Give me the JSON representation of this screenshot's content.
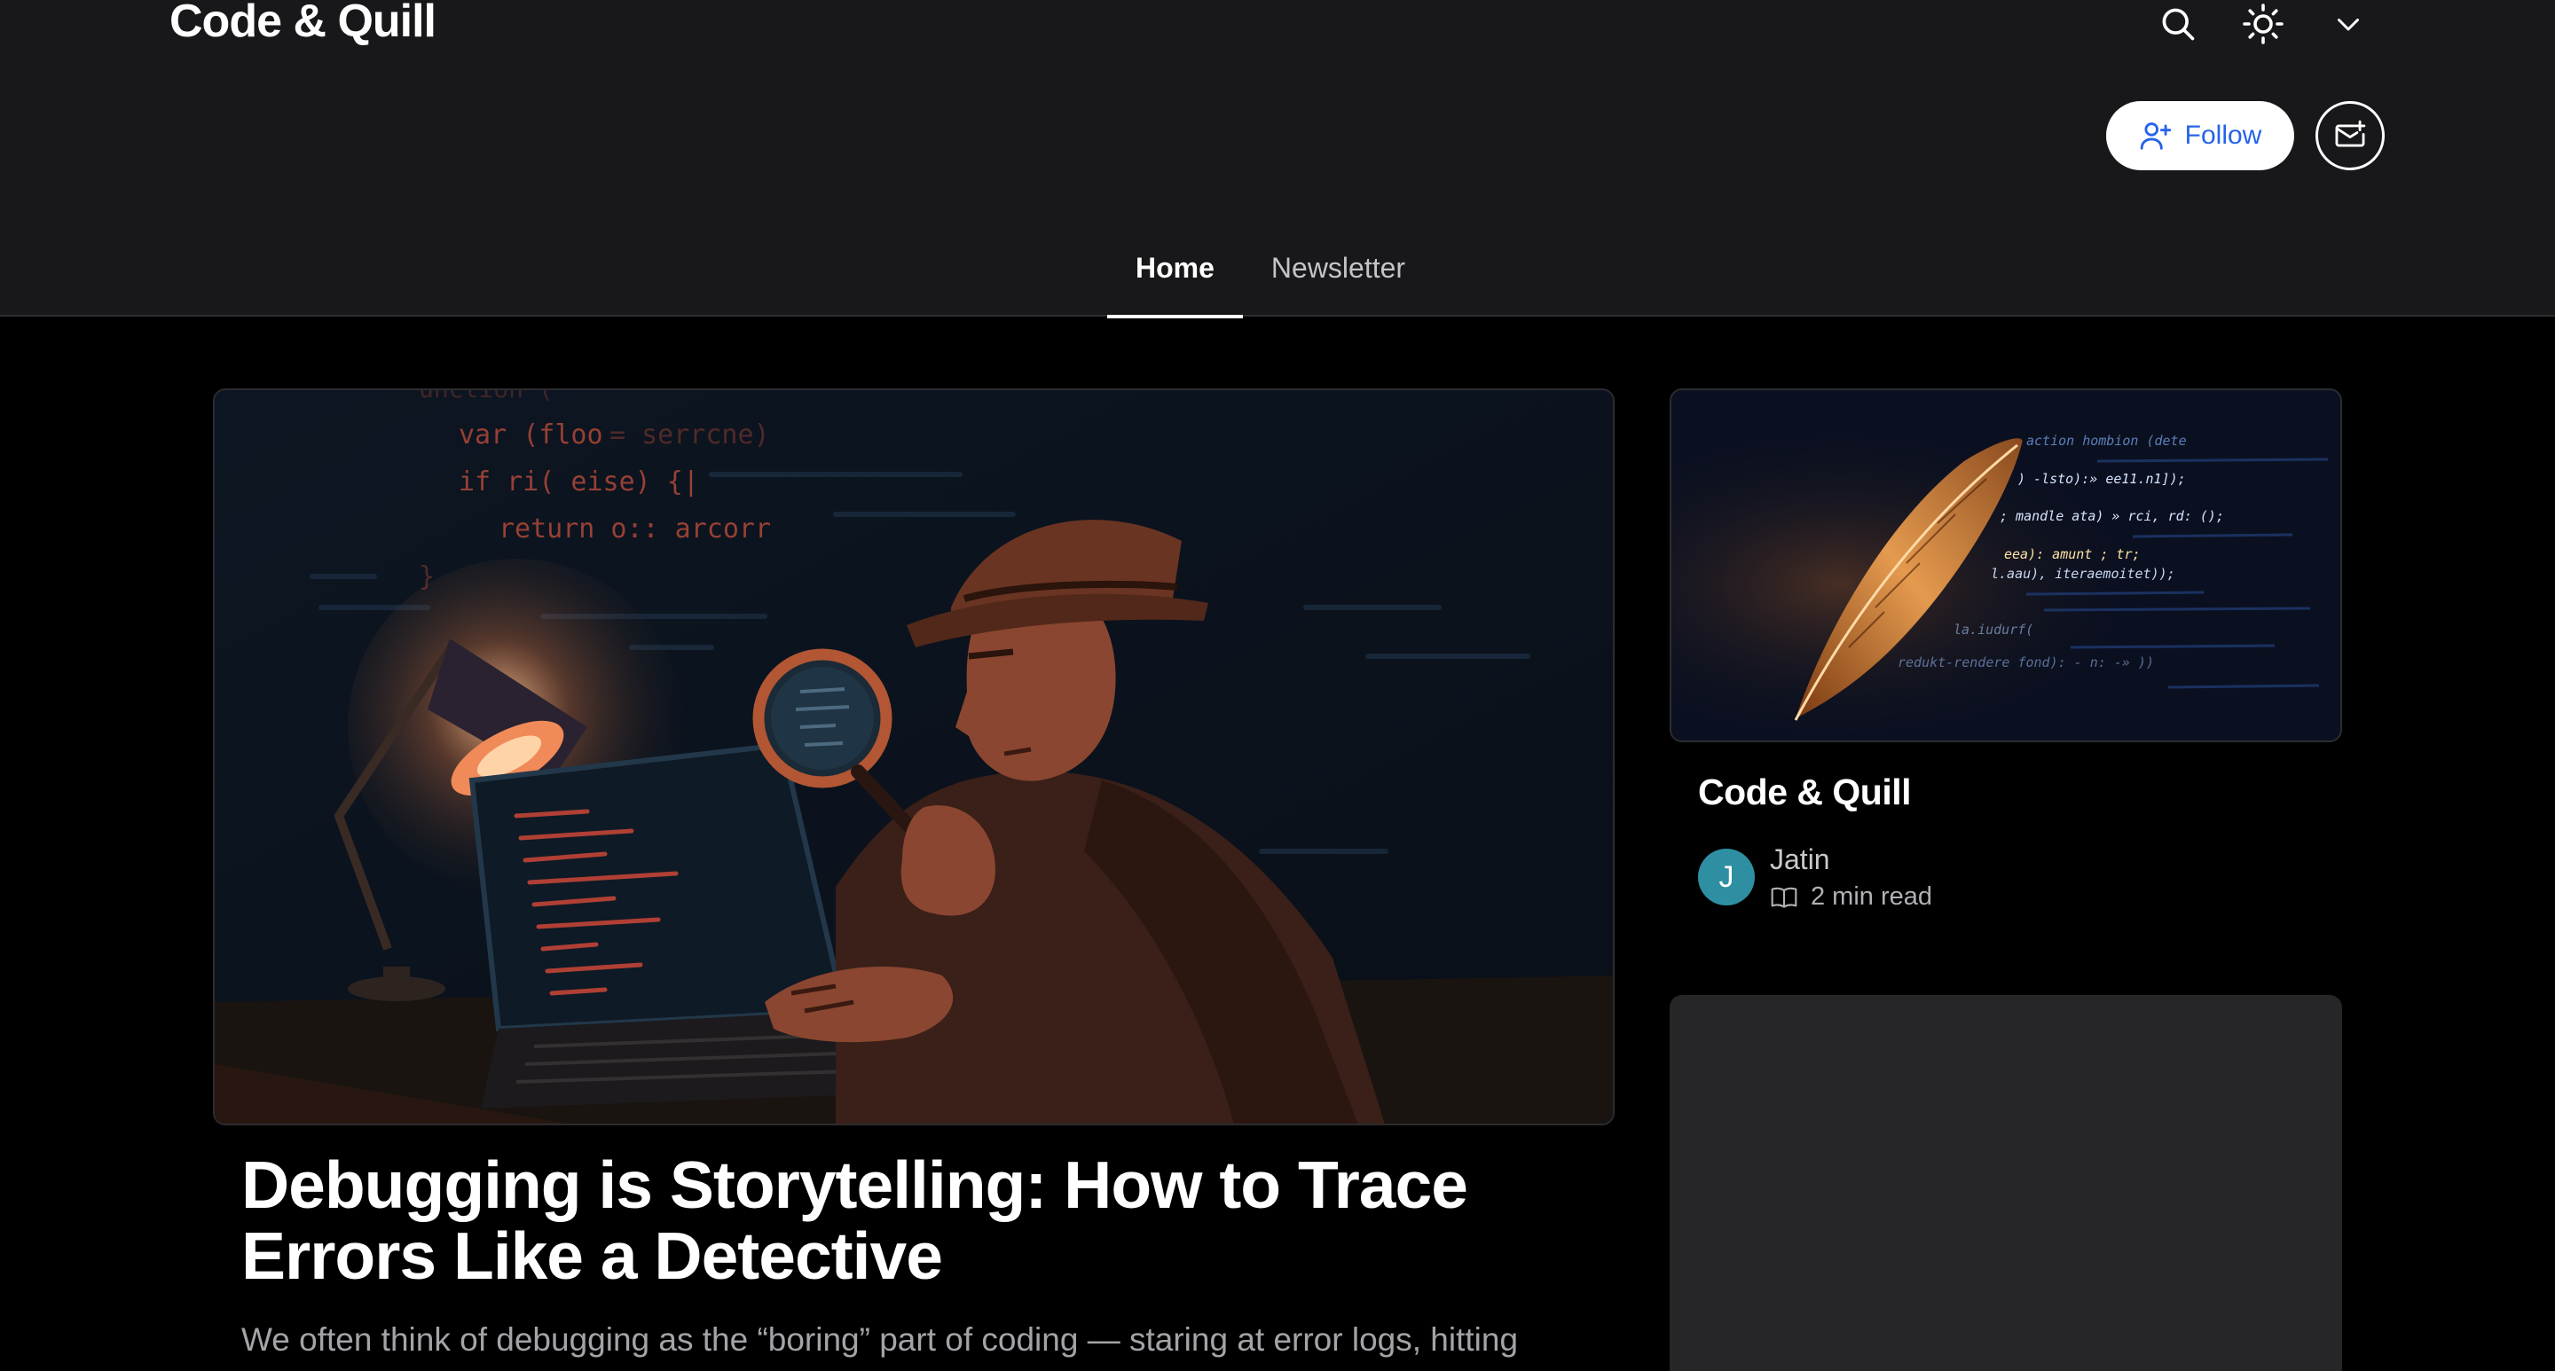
{
  "header": {
    "blog_title": "Code & Quill",
    "follow_label": "Follow",
    "tabs": [
      {
        "label": "Home",
        "active": true
      },
      {
        "label": "Newsletter",
        "active": false
      }
    ],
    "icons": [
      "search-icon",
      "sun-icon",
      "chevron-down-icon",
      "user-plus-icon",
      "mail-plus-icon"
    ]
  },
  "featured_post": {
    "cover_code_lines": [
      "unction (",
      "var (floo",
      "= serrcne)",
      "if ri( eise) {|",
      "return o::  arcorr"
    ],
    "title": "Debugging is Storytelling: How to Trace Errors Like a Detective",
    "excerpt": "We often think of debugging as the “boring” part of coding — staring at error logs, hitting"
  },
  "sidebar": {
    "card_title": "Code & Quill",
    "cover_code_lines": [
      "action hombion (dete",
      ") -lsto):» ee11.n1]);",
      "; mandle ata) » rci, rd: ();",
      "eea): amunt ; tr;",
      "l.aau), iteraemoitet));",
      "la.iudurf(",
      "redukt-rendere fond): - n: -» ))"
    ],
    "author_name": "Jatin",
    "author_initial": "J",
    "read_time": "2 min read"
  },
  "colors": {
    "header_bg": "#18181b",
    "page_bg": "#000000",
    "follow_text": "#2563eb",
    "avatar_bg": "#2f8fa2",
    "side_card_bg": "#262628"
  }
}
